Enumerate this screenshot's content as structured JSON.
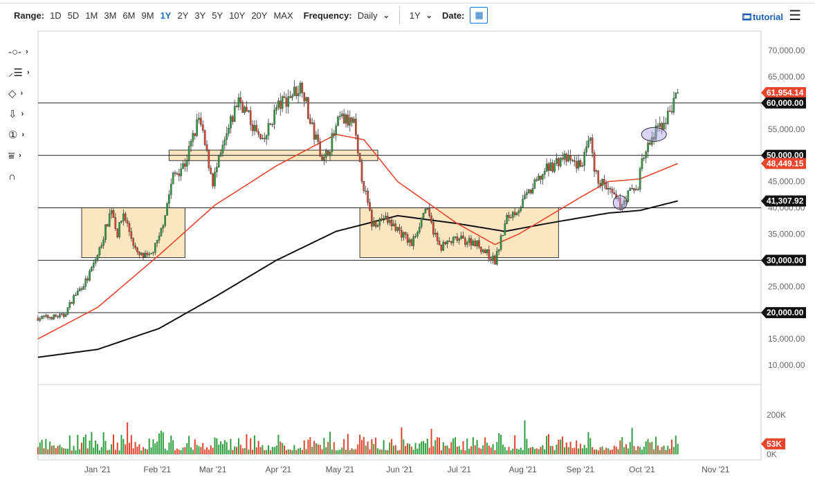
{
  "toolbar": {
    "range_label": "Range:",
    "ranges": [
      "1D",
      "5D",
      "1M",
      "3M",
      "6M",
      "9M",
      "1Y",
      "2Y",
      "3Y",
      "5Y",
      "10Y",
      "20Y",
      "MAX"
    ],
    "active_range": "1Y",
    "frequency_label": "Frequency:",
    "frequency": "Daily",
    "period": "1Y",
    "date_label": "Date:",
    "tutorial": "tutorial"
  },
  "tools": [
    "line-tool",
    "fib-tool",
    "shape-tool",
    "arrow-tool",
    "number-tool",
    "measure-tool",
    "magnet-tool"
  ],
  "colors": {
    "up": "#2e9e3e",
    "down": "#e0442c",
    "ma50": "#e8452c",
    "ma200": "#111111",
    "box": "#fbe6c2",
    "accent": "#1a6fc4"
  },
  "chart_data": {
    "type": "candlestick",
    "title": "",
    "ylim": [
      10000,
      70000
    ],
    "y_ticks": [
      "10,000.00",
      "15,000.00",
      "20,000.00",
      "25,000.00",
      "30,000.00",
      "35,000.00",
      "40,000.00",
      "45,000.00",
      "50,000.00",
      "55,000.00",
      "60,000.00",
      "65,000.00",
      "70,000.00"
    ],
    "x_ticks": [
      {
        "label": "Jan '21",
        "day": 31
      },
      {
        "label": "Feb '21",
        "day": 61
      },
      {
        "label": "Mar '21",
        "day": 89
      },
      {
        "label": "Apr '21",
        "day": 122
      },
      {
        "label": "May '21",
        "day": 153
      },
      {
        "label": "Jun '21",
        "day": 183
      },
      {
        "label": "Jul '21",
        "day": 213
      },
      {
        "label": "Aug '21",
        "day": 245
      },
      {
        "label": "Sep '21",
        "day": 274
      },
      {
        "label": "Oct '21",
        "day": 305
      },
      {
        "label": "Nov '21",
        "day": 342
      }
    ],
    "price_keypoints": [
      [
        1,
        19000
      ],
      [
        14,
        19400
      ],
      [
        19,
        23000
      ],
      [
        26,
        26500
      ],
      [
        32,
        32000
      ],
      [
        38,
        40000
      ],
      [
        41,
        35000
      ],
      [
        44,
        39000
      ],
      [
        51,
        31000
      ],
      [
        57,
        30500
      ],
      [
        62,
        34000
      ],
      [
        69,
        46000
      ],
      [
        75,
        48500
      ],
      [
        82,
        57000
      ],
      [
        89,
        45000
      ],
      [
        102,
        61000
      ],
      [
        114,
        52000
      ],
      [
        121,
        59000
      ],
      [
        134,
        63500
      ],
      [
        138,
        56000
      ],
      [
        145,
        49000
      ],
      [
        153,
        57000
      ],
      [
        160,
        56000
      ],
      [
        162,
        49500
      ],
      [
        169,
        37000
      ],
      [
        175,
        38000
      ],
      [
        182,
        36000
      ],
      [
        189,
        33000
      ],
      [
        196,
        40000
      ],
      [
        203,
        32500
      ],
      [
        212,
        34000
      ],
      [
        221,
        33500
      ],
      [
        231,
        29800
      ],
      [
        237,
        38000
      ],
      [
        243,
        40000
      ],
      [
        256,
        47000
      ],
      [
        265,
        49500
      ],
      [
        274,
        48000
      ],
      [
        279,
        52500
      ],
      [
        281,
        46500
      ],
      [
        294,
        40500
      ],
      [
        299,
        43000
      ],
      [
        303,
        43800
      ],
      [
        304,
        48000
      ],
      [
        308,
        51500
      ],
      [
        313,
        55000
      ],
      [
        318,
        57500
      ],
      [
        323,
        62000
      ]
    ],
    "ma50_keypoints": [
      [
        1,
        15000
      ],
      [
        31,
        21000
      ],
      [
        62,
        31000
      ],
      [
        90,
        40500
      ],
      [
        121,
        48000
      ],
      [
        151,
        54000
      ],
      [
        165,
        53000
      ],
      [
        182,
        45000
      ],
      [
        212,
        37000
      ],
      [
        231,
        33000
      ],
      [
        243,
        35000
      ],
      [
        274,
        42000
      ],
      [
        288,
        45000
      ],
      [
        304,
        45500
      ],
      [
        323,
        48449
      ]
    ],
    "ma200_keypoints": [
      [
        1,
        11500
      ],
      [
        31,
        13000
      ],
      [
        62,
        17000
      ],
      [
        90,
        23000
      ],
      [
        121,
        30000
      ],
      [
        151,
        35500
      ],
      [
        182,
        38500
      ],
      [
        212,
        37000
      ],
      [
        236,
        35500
      ],
      [
        257,
        37000
      ],
      [
        288,
        39000
      ],
      [
        304,
        39500
      ],
      [
        323,
        41308
      ]
    ],
    "horizontal_levels": [
      60000,
      50000,
      40000,
      30000,
      20000
    ],
    "boxes": [
      [
        23,
        75,
        30500,
        40000
      ],
      [
        67,
        172,
        49000,
        51000
      ],
      [
        163,
        263,
        30500,
        40000
      ]
    ],
    "ellipses": [
      [
        311,
        54000
      ],
      [
        294,
        41000
      ]
    ],
    "price_labels": [
      {
        "text": "61,954.14",
        "value": 61954.14,
        "color": "#e8452c"
      },
      {
        "text": "60,000.00",
        "value": 60000,
        "color": "#111"
      },
      {
        "text": "50,000.00",
        "value": 50000,
        "color": "#111"
      },
      {
        "text": "48,449.15",
        "value": 48449.15,
        "color": "#e8452c"
      },
      {
        "text": "41,307.92",
        "value": 41307.92,
        "color": "#111"
      },
      {
        "text": "30,000.00",
        "value": 30000,
        "color": "#111"
      },
      {
        "text": "20,000.00",
        "value": 20000,
        "color": "#111"
      }
    ],
    "volume": {
      "ticks": [
        "0K",
        "200K"
      ],
      "max": 250000,
      "last": 53000,
      "last_label": "53K"
    }
  }
}
